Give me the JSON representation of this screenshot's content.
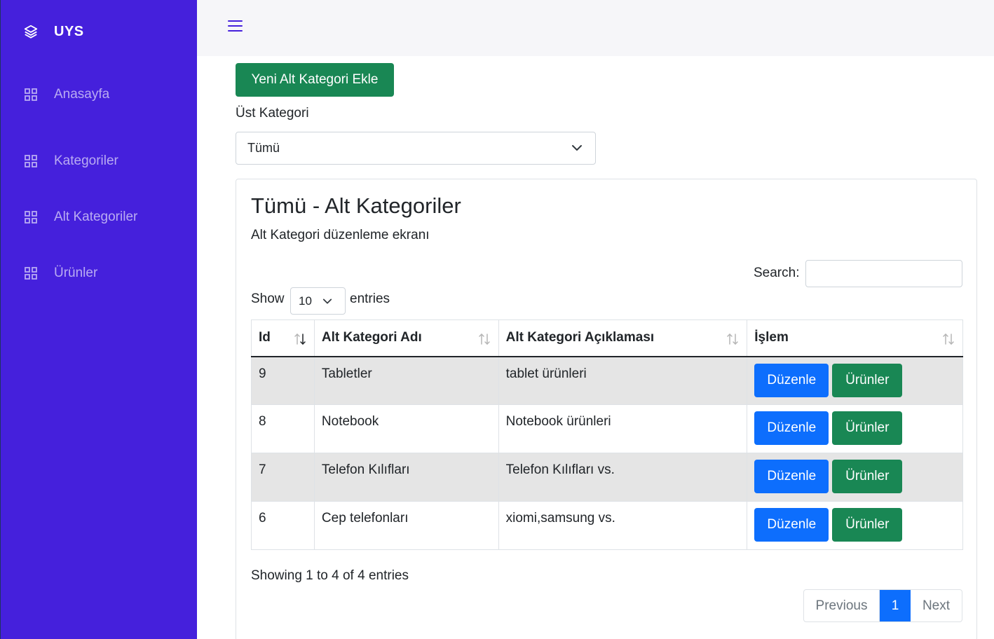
{
  "sidebar": {
    "brand": "UYS",
    "items": [
      {
        "label": "Anasayfa",
        "icon": "grid-icon"
      },
      {
        "label": "Kategoriler",
        "icon": "grid-icon"
      },
      {
        "label": "Alt Kategoriler",
        "icon": "grid-icon"
      },
      {
        "label": "Ürünler",
        "icon": "grid-icon"
      }
    ]
  },
  "colors": {
    "sidebar": "#4520dc",
    "success": "#198754",
    "primary": "#0d6efd",
    "stripe": "#e5e5e5"
  },
  "toolbar": {
    "add_label": "Yeni Alt Kategori Ekle"
  },
  "filter": {
    "label": "Üst Kategori",
    "selected": "Tümü"
  },
  "card": {
    "title": "Tümü - Alt Kategoriler",
    "subtitle": "Alt Kategori düzenleme ekranı"
  },
  "table_controls": {
    "search_label": "Search:",
    "search_value": "",
    "show_label": "Show",
    "page_length": "10",
    "entries_label": "entries"
  },
  "table": {
    "columns": [
      "Id",
      "Alt Kategori Adı",
      "Alt Kategori Açıklaması",
      "İşlem"
    ],
    "rows": [
      {
        "id": "9",
        "name": "Tabletler",
        "description": "tablet ürünleri"
      },
      {
        "id": "8",
        "name": "Notebook",
        "description": "Notebook ürünleri"
      },
      {
        "id": "7",
        "name": "Telefon Kılıfları",
        "description": "Telefon Kılıfları vs."
      },
      {
        "id": "6",
        "name": "Cep telefonları",
        "description": "xiomi,samsung vs."
      }
    ],
    "edit_label": "Düzenle",
    "products_label": "Ürünler"
  },
  "footer": {
    "info": "Showing 1 to 4 of 4 entries",
    "previous": "Previous",
    "page": "1",
    "next": "Next"
  }
}
